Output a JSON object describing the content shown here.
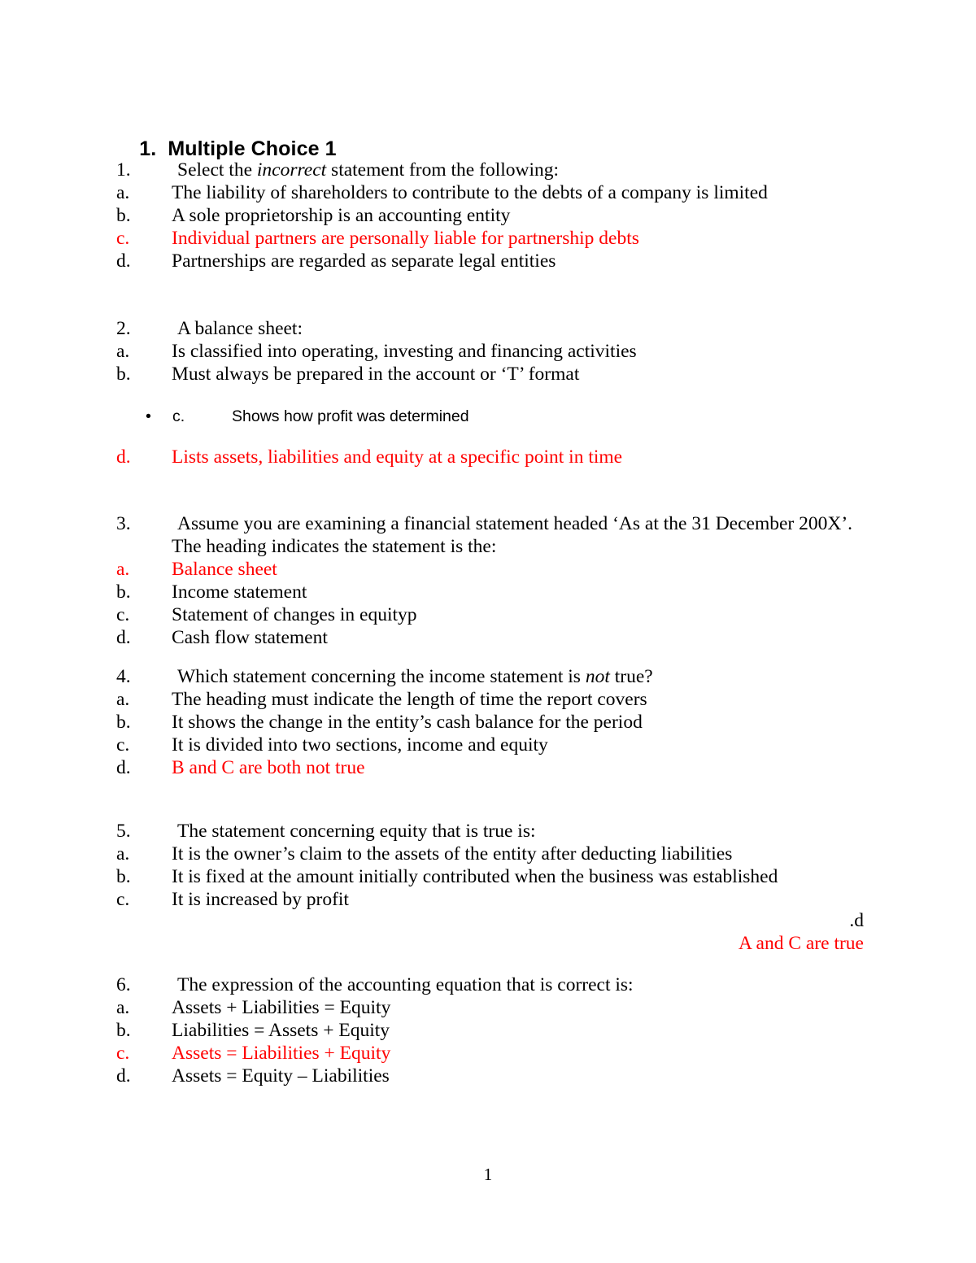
{
  "document": {
    "title_number": "1.",
    "title_text": "Multiple Choice 1",
    "page_number": "1",
    "accent_red": "#FF0000",
    "text_black": "#000000"
  },
  "questions": [
    {
      "number": "1.",
      "stem": "Select the ",
      "stem_italic": "incorrect",
      "stem_tail": " statement from the following:",
      "options": [
        {
          "label": "a.",
          "text": "The liability of shareholders to contribute to the debts of a company is limited",
          "color": "#000000"
        },
        {
          "label": "b.",
          "text": "A sole proprietorship is an accounting entity",
          "color": "#000000"
        },
        {
          "label": "c.",
          "text": "Individual partners are personally liable for partnership debts",
          "color": "#FF0000"
        },
        {
          "label": "d.",
          "text": "Partnerships are regarded as separate legal entities",
          "color": "#000000"
        }
      ]
    },
    {
      "number": "2.",
      "stem": "A balance sheet:",
      "options": [
        {
          "label": "a.",
          "text": "Is classified into operating, investing and financing activities",
          "color": "#000000"
        },
        {
          "label": "b.",
          "text": "Must always be prepared in the account or ‘T’ format",
          "color": "#000000"
        }
      ],
      "bullet_option": {
        "bullet": "•",
        "label": "c.",
        "text": "Shows how profit was determined",
        "color": "#000000"
      },
      "trailing_option": {
        "label": "d.",
        "text": "Lists assets, liabilities and equity at a specific point in time",
        "color": "#FF0000"
      }
    },
    {
      "number": "3.",
      "stem": "Assume you are examining a financial statement headed ‘As at the 31 December 200X’.",
      "stem_line2": "The heading indicates the statement is the:",
      "options": [
        {
          "label": "a.",
          "text": "Balance sheet",
          "color": "#FF0000"
        },
        {
          "label": "b.",
          "text": "Income statement",
          "color": "#000000"
        },
        {
          "label": "c.",
          "text": "Statement of changes in equityp",
          "color": "#000000"
        },
        {
          "label": "d.",
          "text": "Cash flow statement",
          "color": "#000000"
        }
      ]
    },
    {
      "number": "4.",
      "stem": "Which statement concerning the income statement is ",
      "stem_italic": "not",
      "stem_tail": " true?",
      "options": [
        {
          "label": "a.",
          "text": "The heading must indicate the length of time the report covers",
          "color": "#000000"
        },
        {
          "label": "b.",
          "text": "It shows the change in the entity’s cash balance for the period",
          "color": "#000000"
        },
        {
          "label": "c.",
          "text": "It is divided into two sections, income and equity",
          "color": "#000000"
        },
        {
          "label": "d.",
          "text": "B and C are both not true",
          "color": "#FF0000"
        }
      ]
    },
    {
      "number": "5.",
      "stem": "The statement concerning equity that is true is:",
      "options": [
        {
          "label": "a.",
          "text": "It is the owner’s claim to the assets of the entity after deducting liabilities",
          "color": "#000000"
        },
        {
          "label": "b.",
          "text": "It is fixed at the amount initially contributed when the business was established",
          "color": "#000000"
        },
        {
          "label": "c.",
          "text": "It is increased by profit",
          "color": "#000000"
        }
      ],
      "right_label": ".d",
      "right_text": "A and C are true",
      "right_text_color": "#FF0000"
    },
    {
      "number": "6.",
      "stem": "The expression of the accounting equation that is correct is:",
      "options": [
        {
          "label": "a.",
          "text": "Assets + Liabilities = Equity",
          "color": "#000000"
        },
        {
          "label": "b.",
          "text": "Liabilities = Assets + Equity",
          "color": "#000000"
        },
        {
          "label": "c.",
          "text": "Assets = Liabilities + Equity",
          "color": "#FF0000"
        },
        {
          "label": "d.",
          "text": "Assets = Equity – Liabilities",
          "color": "#000000"
        }
      ]
    }
  ]
}
